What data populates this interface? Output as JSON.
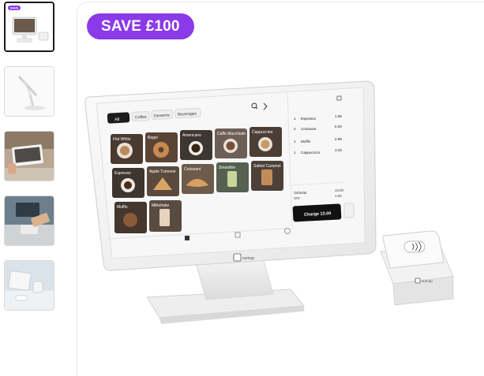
{
  "badge": {
    "label": "SAVE £100",
    "color": "#8a3ae8"
  },
  "thumbnails": [
    {
      "name": "pos-bundle-front",
      "selected": true,
      "tag": "SAVE"
    },
    {
      "name": "pos-stand-side",
      "selected": false
    },
    {
      "name": "pos-in-store",
      "selected": false
    },
    {
      "name": "card-reader-payment",
      "selected": false
    },
    {
      "name": "pos-counter",
      "selected": false
    }
  ],
  "pos": {
    "tabs": [
      "All",
      "Coffee",
      "Desserts",
      "Beverages"
    ],
    "tiles": [
      "Flat White",
      "Bagel",
      "Americano",
      "Caffe Macchiato",
      "Cappuccino",
      "Espresso",
      "Apple Turnover",
      "Croissant",
      "Smoothie",
      "Salted Caramel",
      "Muffin",
      "Milkshake"
    ],
    "order": [
      {
        "qty": "1",
        "item": "Espresso",
        "price": "1.95"
      },
      {
        "qty": "2",
        "item": "Croissant",
        "price": "5.00"
      },
      {
        "qty": "1",
        "item": "Muffin",
        "price": "2.95"
      },
      {
        "qty": "1",
        "item": "Cappuccino",
        "price": "3.20"
      }
    ],
    "subtotal_label": "Subtotal",
    "subtotal_value": "13.00",
    "vat_label": "VAT",
    "vat_value": "1.00",
    "charge_label": "Charge 13.00",
    "brand": "sumup"
  },
  "reader": {
    "brand": "sumup"
  }
}
